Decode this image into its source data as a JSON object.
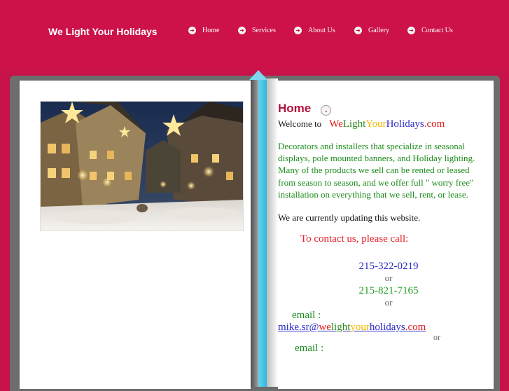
{
  "header": {
    "site_title": "We Light Your Holidays",
    "nav": [
      {
        "label": "Home",
        "icon": "arrow-right-icon"
      },
      {
        "label": "Services",
        "icon": "arrow-right-icon"
      },
      {
        "label": "About Us",
        "icon": "arrow-right-icon"
      },
      {
        "label": "Gallery",
        "icon": "arrow-right-icon"
      },
      {
        "label": "Contact Us",
        "icon": "arrow-right-icon"
      }
    ]
  },
  "main": {
    "heading": "Home",
    "welcome_prefix": "Welcome to",
    "brand": {
      "we": "We",
      "light": "Light",
      "your": "Your",
      "holidays": "Holidays",
      "com": ".com"
    },
    "description": "Decorators and installers that specialize in seasonal displays, pole mounted banners, and Holiday lighting. Many of the products we sell can be rented or leased from season to season, and we offer full \" worry free\" installation on everything that we sell, rent, or lease.",
    "update_notice": "We are currently updating this website.",
    "contact_heading": "To contact us, please call:",
    "phone_1": "215-322-0219",
    "or_1": "or",
    "phone_2": "215-821-7165",
    "or_2": "or",
    "email_label": "email :",
    "email": {
      "user": "mike.sr@",
      "we": "we",
      "light": "light",
      "your": "your",
      "holidays": "holidays",
      "com": ".com"
    },
    "or_3": "or",
    "email_label_2": "email :"
  },
  "colors": {
    "background": "#c8124a",
    "heading": "#b5123f",
    "body_text_green": "#1d8d1d",
    "bookmark": "#2fb8db"
  }
}
